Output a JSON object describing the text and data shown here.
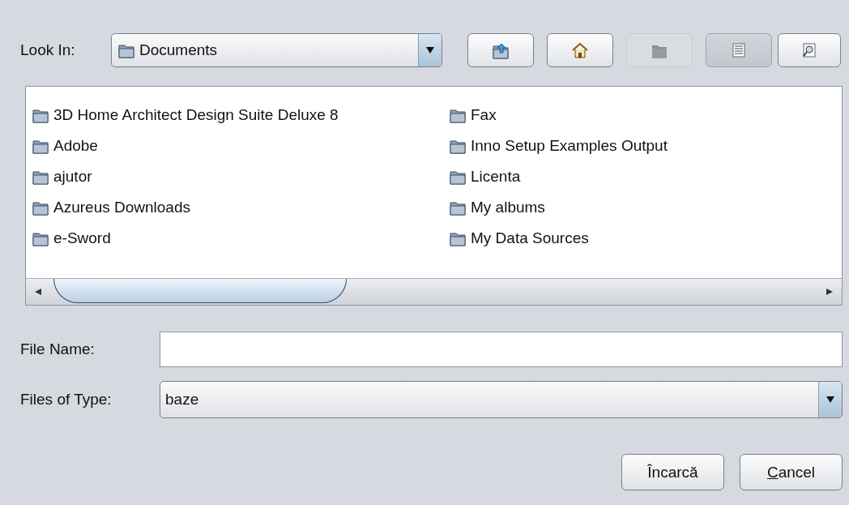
{
  "look_in": {
    "label": "Look In:",
    "value": "Documents"
  },
  "toolbar": [
    {
      "kind": "up",
      "disabled": false,
      "selected": false
    },
    {
      "kind": "home",
      "disabled": false,
      "selected": false
    },
    {
      "kind": "new-folder",
      "disabled": true,
      "selected": false
    },
    {
      "kind": "list",
      "disabled": false,
      "selected": true
    },
    {
      "kind": "details",
      "disabled": false,
      "selected": false
    }
  ],
  "files": [
    {
      "name": "3D Home Architect Design Suite Deluxe 8"
    },
    {
      "name": "Adobe"
    },
    {
      "name": "ajutor"
    },
    {
      "name": "Azureus Downloads"
    },
    {
      "name": "e-Sword"
    },
    {
      "name": "Fax"
    },
    {
      "name": "Inno Setup Examples Output"
    },
    {
      "name": "Licenta"
    },
    {
      "name": "My albums"
    },
    {
      "name": "My Data Sources"
    }
  ],
  "file_name": {
    "label": "File Name:"
  },
  "files_of_type": {
    "label": "Files of Type:",
    "value": "baze"
  },
  "buttons": [
    {
      "parts": [
        {
          "text": "Încarcă",
          "underlined": false
        }
      ]
    },
    {
      "parts": [
        {
          "text": "C",
          "underlined": true
        },
        {
          "text": "ancel",
          "underlined": false
        }
      ]
    }
  ]
}
